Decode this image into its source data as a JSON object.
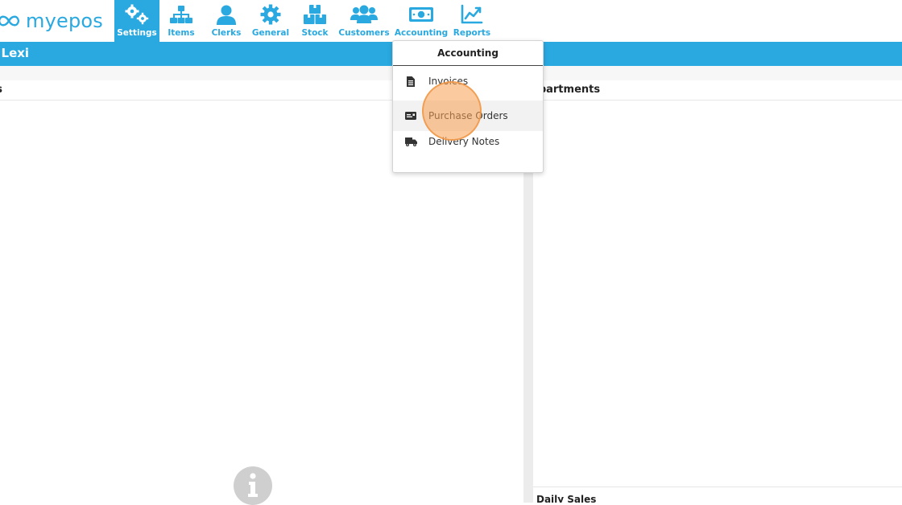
{
  "app": {
    "logo_text": "myepos",
    "brand_color": "#29a9e0"
  },
  "nav": {
    "items": [
      {
        "label": "Settings",
        "icon": "gears-icon"
      },
      {
        "label": "Items",
        "icon": "sitemap-icon"
      },
      {
        "label": "Clerks",
        "icon": "user-icon"
      },
      {
        "label": "General",
        "icon": "gear-icon"
      },
      {
        "label": "Stock",
        "icon": "boxes-icon"
      },
      {
        "label": "Customers",
        "icon": "users-icon"
      },
      {
        "label": "Accounting",
        "icon": "money-bill-icon"
      },
      {
        "label": "Reports",
        "icon": "chart-line-icon"
      }
    ],
    "active": "Settings"
  },
  "welcome_bar": {
    "text": "o Lexi"
  },
  "panels": {
    "left_title": "les",
    "right_title": "epartments",
    "bottom_right_title": "Daily Sales"
  },
  "dropdown": {
    "title": "Accounting",
    "items": [
      {
        "label": "Invoices",
        "icon": "file-invoice-icon"
      },
      {
        "label": "Purchase Orders",
        "icon": "purchase-order-icon"
      },
      {
        "label": "Delivery Notes",
        "icon": "truck-icon"
      }
    ],
    "hovered": "Purchase Orders"
  }
}
